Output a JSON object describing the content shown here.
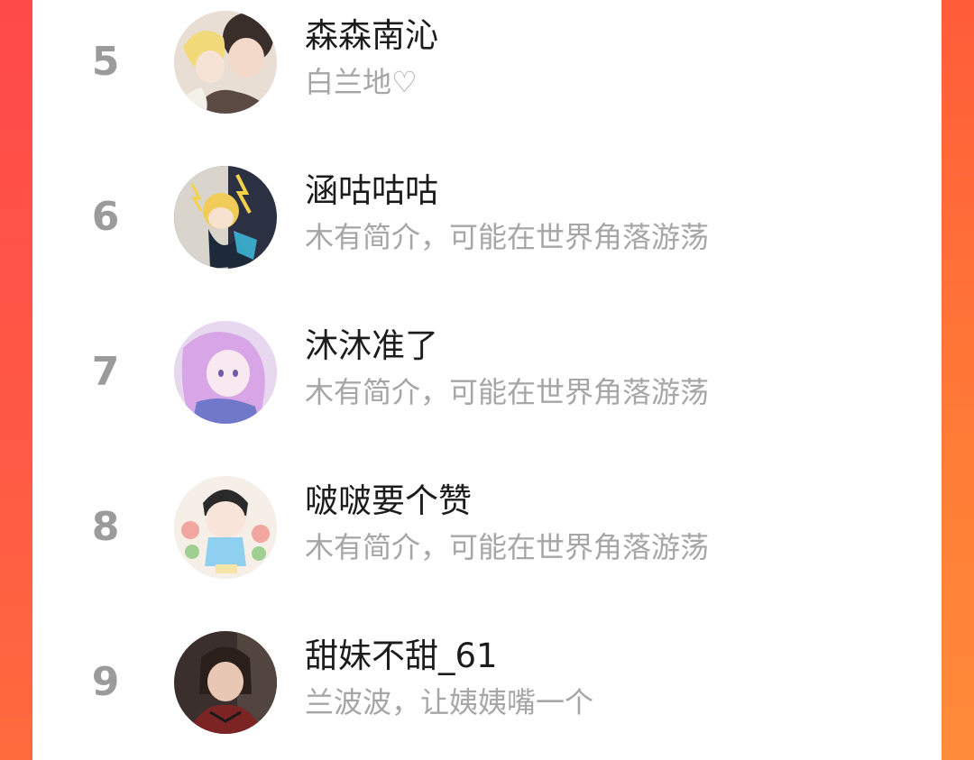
{
  "ranking": {
    "items": [
      {
        "rank": "5",
        "name": "森森南沁",
        "bio": "白兰地♡"
      },
      {
        "rank": "6",
        "name": "涵咕咕咕",
        "bio": "木有简介，可能在世界角落游荡"
      },
      {
        "rank": "7",
        "name": "沐沐准了",
        "bio": "木有简介，可能在世界角落游荡"
      },
      {
        "rank": "8",
        "name": "啵啵要个赞",
        "bio": "木有简介，可能在世界角落游荡"
      },
      {
        "rank": "9",
        "name": "甜妹不甜_61",
        "bio": "兰波波，让姨姨嘴一个"
      }
    ]
  },
  "colors": {
    "accent_left": "#ff4a4a",
    "accent_right": "#ff7a36",
    "rank_number": "#9b9b9b",
    "name_text": "#1c1c1c",
    "bio_text": "#a6a6a6"
  }
}
